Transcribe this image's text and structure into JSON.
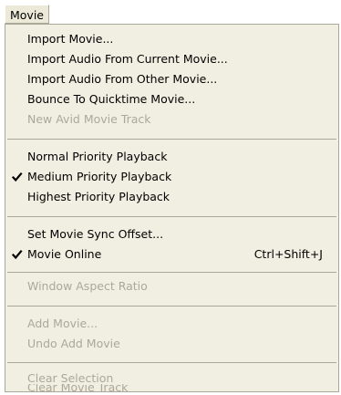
{
  "menubar": {
    "title": "Movie"
  },
  "menu": {
    "items": [
      {
        "label": "Import Movie...",
        "enabled": true,
        "checked": false,
        "shortcut": ""
      },
      {
        "label": "Import Audio From Current Movie...",
        "enabled": true,
        "checked": false,
        "shortcut": ""
      },
      {
        "label": "Import Audio From Other Movie...",
        "enabled": true,
        "checked": false,
        "shortcut": ""
      },
      {
        "label": "Bounce To Quicktime Movie...",
        "enabled": true,
        "checked": false,
        "shortcut": ""
      },
      {
        "label": "New Avid Movie Track",
        "enabled": false,
        "checked": false,
        "shortcut": ""
      },
      {
        "label": "Normal Priority Playback",
        "enabled": true,
        "checked": false,
        "shortcut": ""
      },
      {
        "label": "Medium Priority Playback",
        "enabled": true,
        "checked": true,
        "shortcut": ""
      },
      {
        "label": "Highest Priority Playback",
        "enabled": true,
        "checked": false,
        "shortcut": ""
      },
      {
        "label": "Set Movie Sync Offset...",
        "enabled": true,
        "checked": false,
        "shortcut": ""
      },
      {
        "label": "Movie Online",
        "enabled": true,
        "checked": true,
        "shortcut": "Ctrl+Shift+J"
      },
      {
        "label": "Window Aspect Ratio",
        "enabled": false,
        "checked": false,
        "shortcut": ""
      },
      {
        "label": "Add Movie...",
        "enabled": false,
        "checked": false,
        "shortcut": ""
      },
      {
        "label": "Undo Add Movie",
        "enabled": false,
        "checked": false,
        "shortcut": ""
      },
      {
        "label": "Clear Selection",
        "enabled": false,
        "checked": false,
        "shortcut": ""
      },
      {
        "label": "Clear Movie Track",
        "enabled": false,
        "checked": false,
        "shortcut": ""
      }
    ]
  },
  "icons": {
    "check": "checkmark-icon"
  },
  "colors": {
    "menu_background": "#f1efe2",
    "menubar_item_background": "#ece9d8",
    "disabled_text": "#aca899",
    "separator": "#aca899",
    "text": "#000000"
  }
}
